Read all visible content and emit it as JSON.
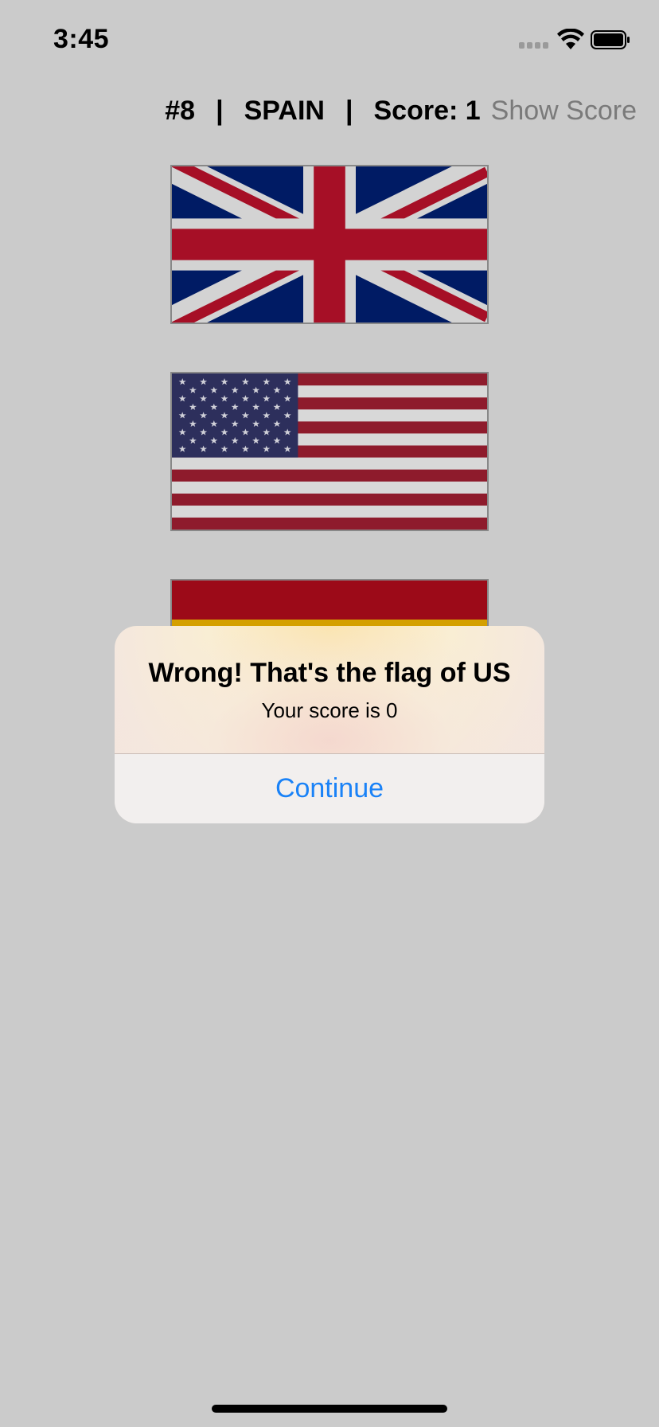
{
  "status_bar": {
    "time": "3:45",
    "icons": [
      "cellular-signal-icon",
      "wifi-icon",
      "battery-icon"
    ]
  },
  "header": {
    "question_number": "#8",
    "separator": "|",
    "country": "SPAIN",
    "score": "Score: 1",
    "show_score_label": "Show Score"
  },
  "flags": [
    {
      "country": "UK"
    },
    {
      "country": "US"
    },
    {
      "country": "Spain"
    }
  ],
  "alert": {
    "title": "Wrong! That's the flag of US",
    "message": "Your score is 0",
    "button_label": "Continue"
  },
  "colors": {
    "background": "#cbcbcb",
    "accent": "#1a82f7",
    "uk_blue": "#001b64",
    "uk_red": "#a60f26",
    "us_blue": "#2d2f5c",
    "us_red": "#8e1b2c",
    "spain_red": "#9c0a18",
    "spain_yellow": "#d4a000"
  }
}
